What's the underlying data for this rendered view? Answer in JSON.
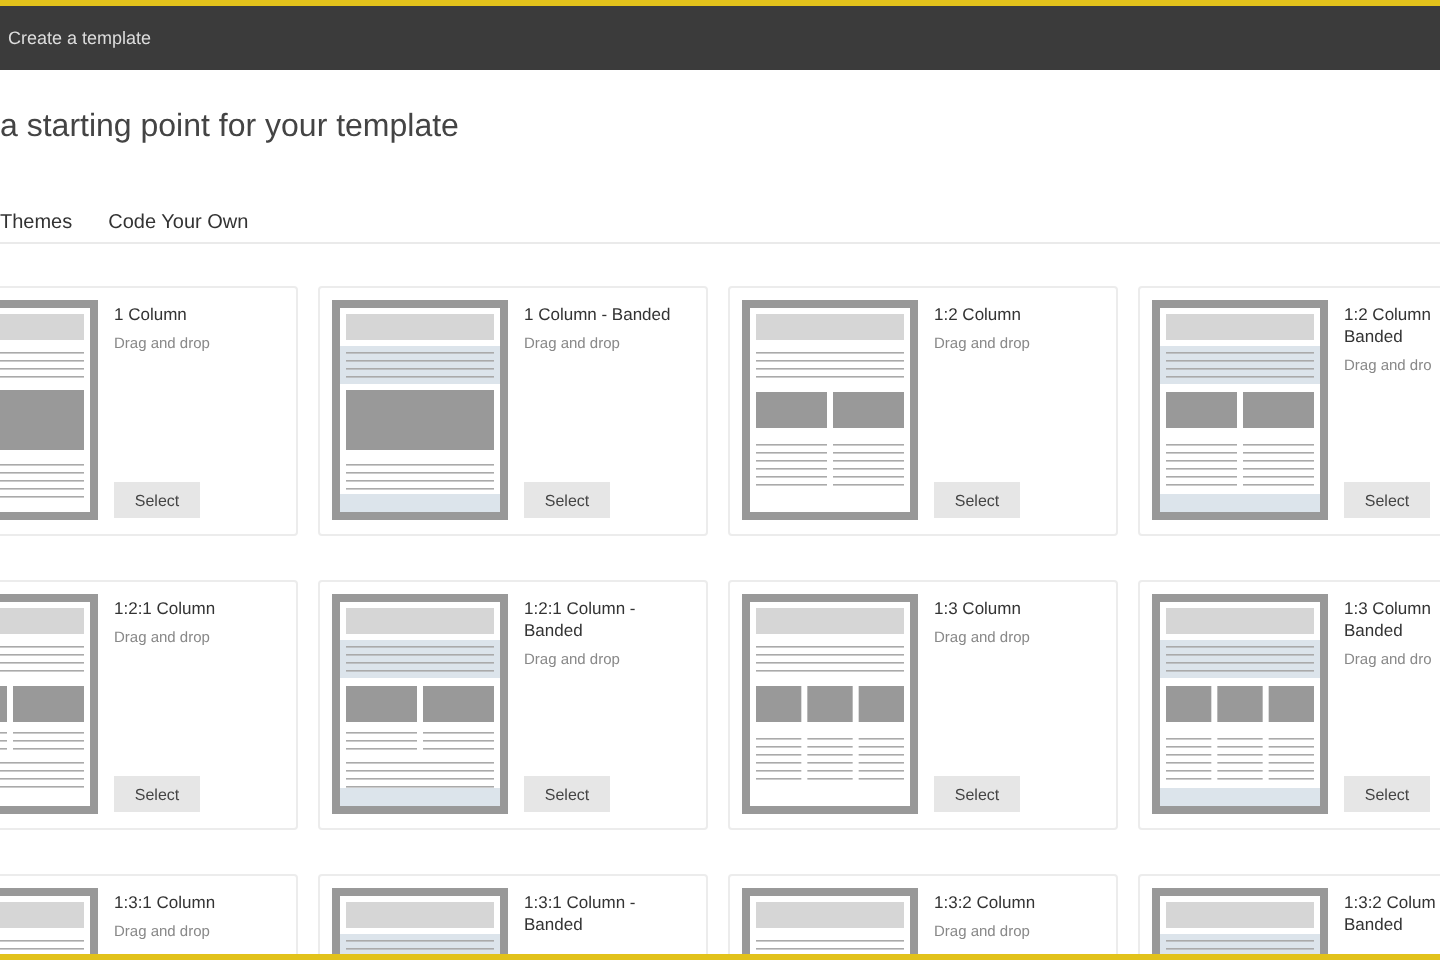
{
  "header": {
    "title": "Create a template"
  },
  "heading": "a starting point for your template",
  "tabs": [
    {
      "label": "Themes"
    },
    {
      "label": "Code Your Own"
    }
  ],
  "cards": [
    {
      "title": "1 Column",
      "description": "Drag and drop",
      "button": "Select",
      "kind": "one",
      "banded": false
    },
    {
      "title": "1 Column - Banded",
      "description": "Drag and drop",
      "button": "Select",
      "kind": "one",
      "banded": true
    },
    {
      "title": "1:2 Column",
      "description": "Drag and drop",
      "button": "Select",
      "kind": "two",
      "banded": false
    },
    {
      "title": "1:2 Column Banded",
      "description": "Drag and dro",
      "button": "Select",
      "kind": "two",
      "banded": true
    },
    {
      "title": "1:2:1 Column",
      "description": "Drag and drop",
      "button": "Select",
      "kind": "two-one",
      "banded": false
    },
    {
      "title": "1:2:1 Column - Banded",
      "description": "Drag and drop",
      "button": "Select",
      "kind": "two-one",
      "banded": true
    },
    {
      "title": "1:3 Column",
      "description": "Drag and drop",
      "button": "Select",
      "kind": "three",
      "banded": false
    },
    {
      "title": "1:3 Column Banded",
      "description": "Drag and dro",
      "button": "Select",
      "kind": "three",
      "banded": true
    },
    {
      "title": "1:3:1 Column",
      "description": "Drag and drop",
      "kind": "three-one",
      "banded": false
    },
    {
      "title": "1:3:1 Column - Banded",
      "kind": "three-one",
      "banded": true
    },
    {
      "title": "1:3:2 Column",
      "description": "Drag and drop",
      "kind": "three-two",
      "banded": false
    },
    {
      "title": "1:3:2 Colum Banded",
      "kind": "three-two",
      "banded": true
    }
  ]
}
